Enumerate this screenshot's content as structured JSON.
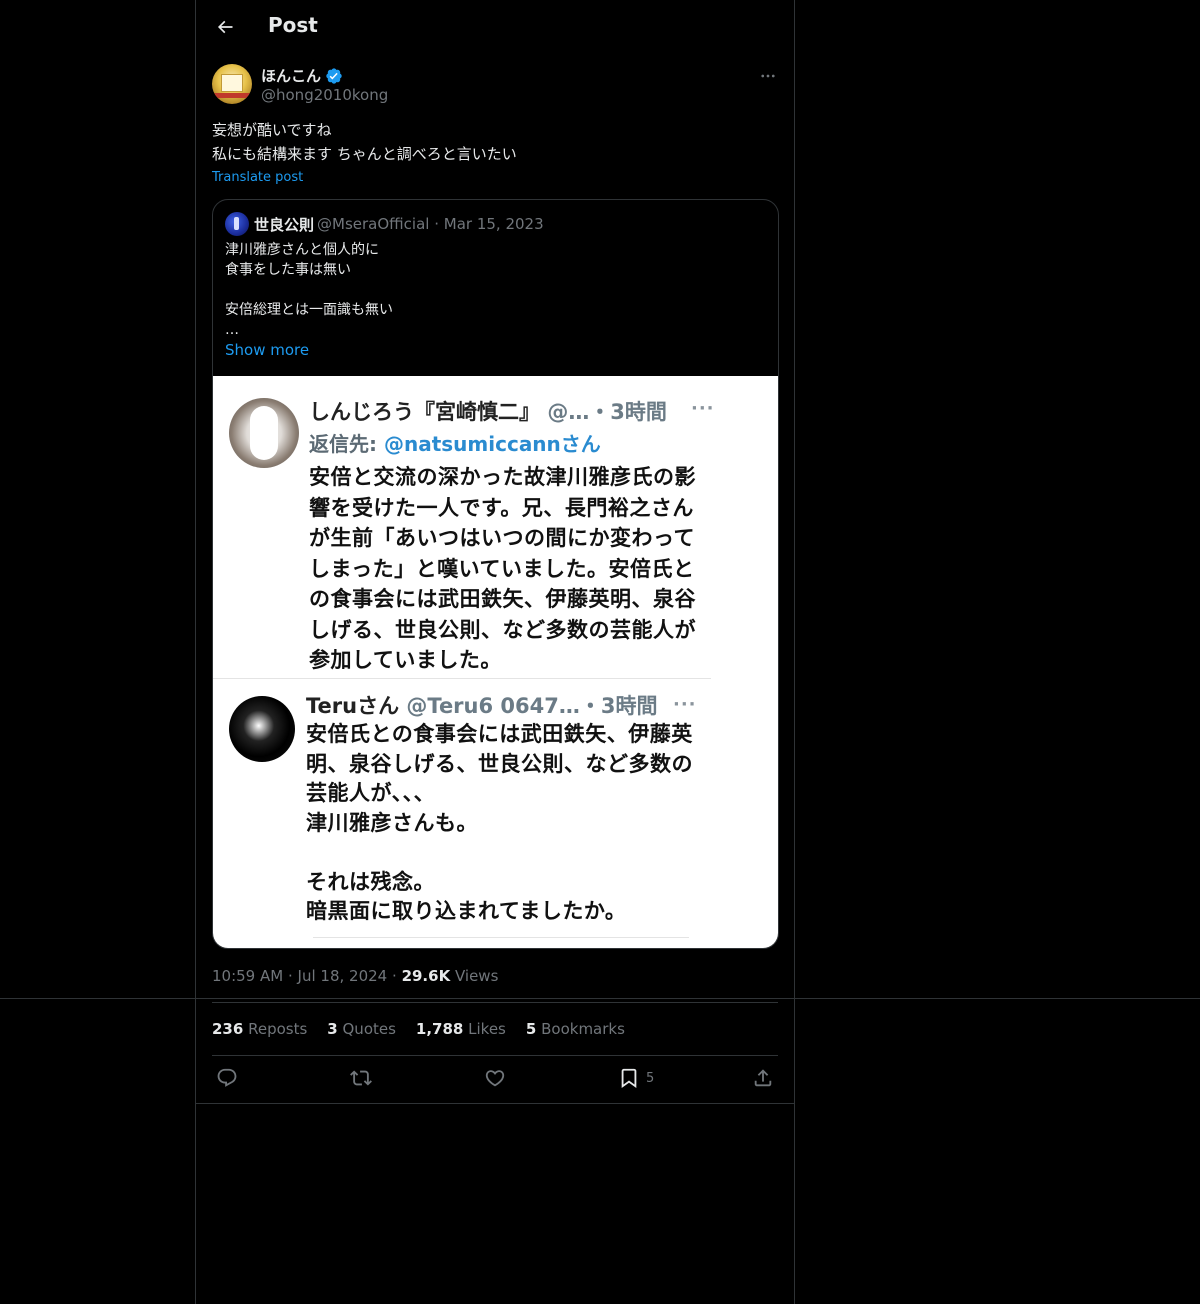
{
  "header": {
    "title": "Post"
  },
  "post": {
    "author": {
      "display_name": "ほんこん",
      "handle": "@hong2010kong"
    },
    "text": "妄想が酷いですね\n私にも結構来ます ちゃんと調べろと言いたい",
    "translate_label": "Translate post",
    "time": "10:59 AM",
    "date": "Jul 18, 2024",
    "views_count": "29.6K",
    "views_label": "Views",
    "separator": "·"
  },
  "quote": {
    "display_name": "世良公則",
    "handle": "@MseraOfficial",
    "date": "Mar 15, 2023",
    "separator": "·",
    "text": "津川雅彦さんと個人的に\n食事をした事は無い\n\n安倍総理とは一面識も無い\n…",
    "show_more": "Show more",
    "screenshot": {
      "tweet1": {
        "name": "しんじろう『宮崎慎二』",
        "handle_time": "@…・3時間",
        "more": "···",
        "reply_prefix": "返信先:",
        "reply_mention": "@natsumiccann",
        "reply_suffix": "さん",
        "body": "安倍と交流の深かった故津川雅彦氏の影\n響を受けた一人です。兄、長門裕之さん\nが生前「あいつはいつの間にか変わって\nしまった」と嘆いていました。安倍氏と\nの食事会には武田鉄矢、伊藤英明、泉谷\nしげる、世良公則、など多数の芸能人が\n参加していました。"
      },
      "tweet2": {
        "name": "Teruさん",
        "handle_time": "@Teru6 0647…・3時間",
        "more": "···",
        "body": "安倍氏との食事会には武田鉄矢、伊藤英\n明、泉谷しげる、世良公則、など多数の\n芸能人が、、、\n津川雅彦さんも。\n\nそれは残念。\n暗黒面に取り込まれてましたか。"
      }
    }
  },
  "stats": {
    "reposts_count": "236",
    "reposts_label": "Reposts",
    "quotes_count": "3",
    "quotes_label": "Quotes",
    "likes_count": "1,788",
    "likes_label": "Likes",
    "bookmarks_count": "5",
    "bookmarks_label": "Bookmarks"
  },
  "actions": {
    "bookmark_count": "5"
  },
  "colors": {
    "accent": "#1d9bf0",
    "verified": "#1d9bf0",
    "muted": "#71767b",
    "border": "#2f3336"
  }
}
